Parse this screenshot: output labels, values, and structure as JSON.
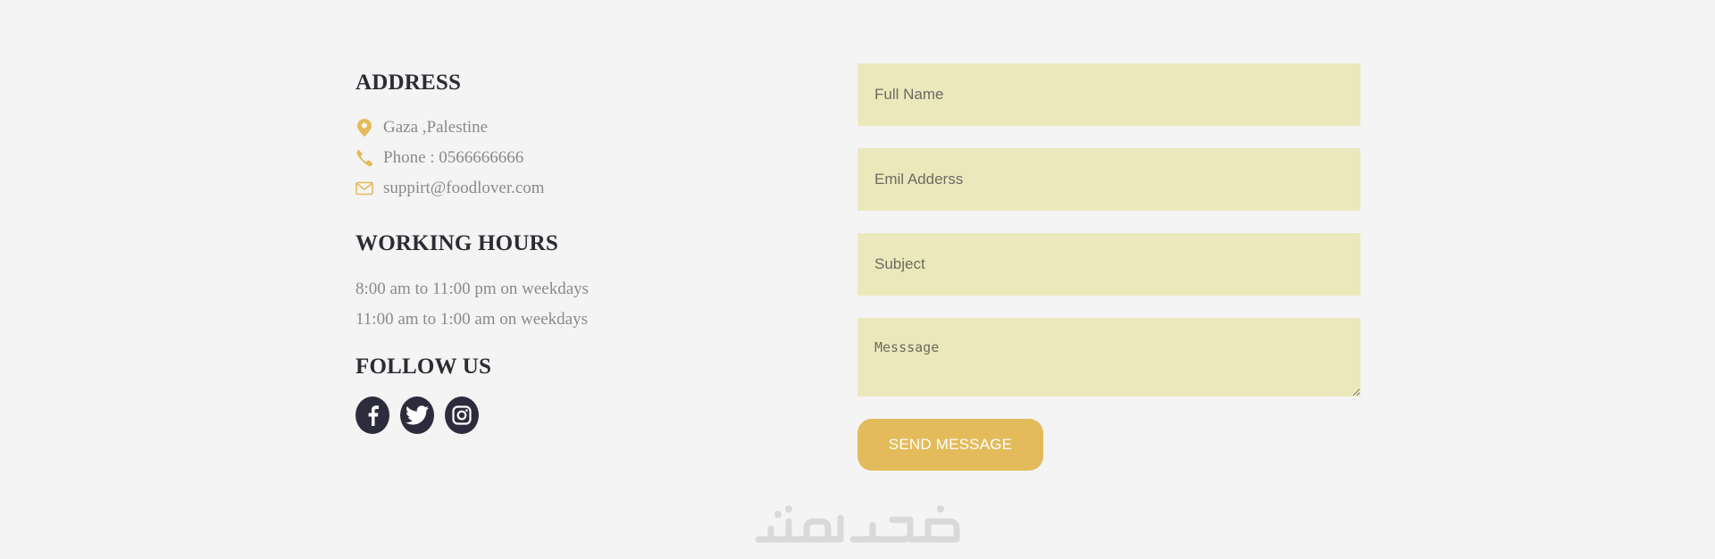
{
  "address": {
    "heading": "ADDRESS",
    "location": "Gaza ,Palestine",
    "phone": "Phone : 0566666666",
    "email": "suppirt@foodlover.com"
  },
  "hours": {
    "heading": "WORKING HOURS",
    "lines": [
      "8:00 am to 11:00 pm on weekdays",
      "11:00 am to 1:00 am on weekdays"
    ]
  },
  "follow": {
    "heading": "FOLLOW US",
    "icons": [
      "facebook-icon",
      "twitter-icon",
      "instagram-icon"
    ]
  },
  "form": {
    "name_placeholder": "Full Name",
    "email_placeholder": "Emil Adderss",
    "subject_placeholder": "Subject",
    "message_placeholder": "Messsage",
    "send_label": "SEND MESSAGE"
  },
  "watermark": "خمسات",
  "colors": {
    "accent": "#e4bb5b",
    "field_bg": "#ebe9bc",
    "heading": "#2c2c34",
    "text": "#8a8a8a",
    "social_bg": "#2c2c3c",
    "background": "#f4f4f4"
  }
}
